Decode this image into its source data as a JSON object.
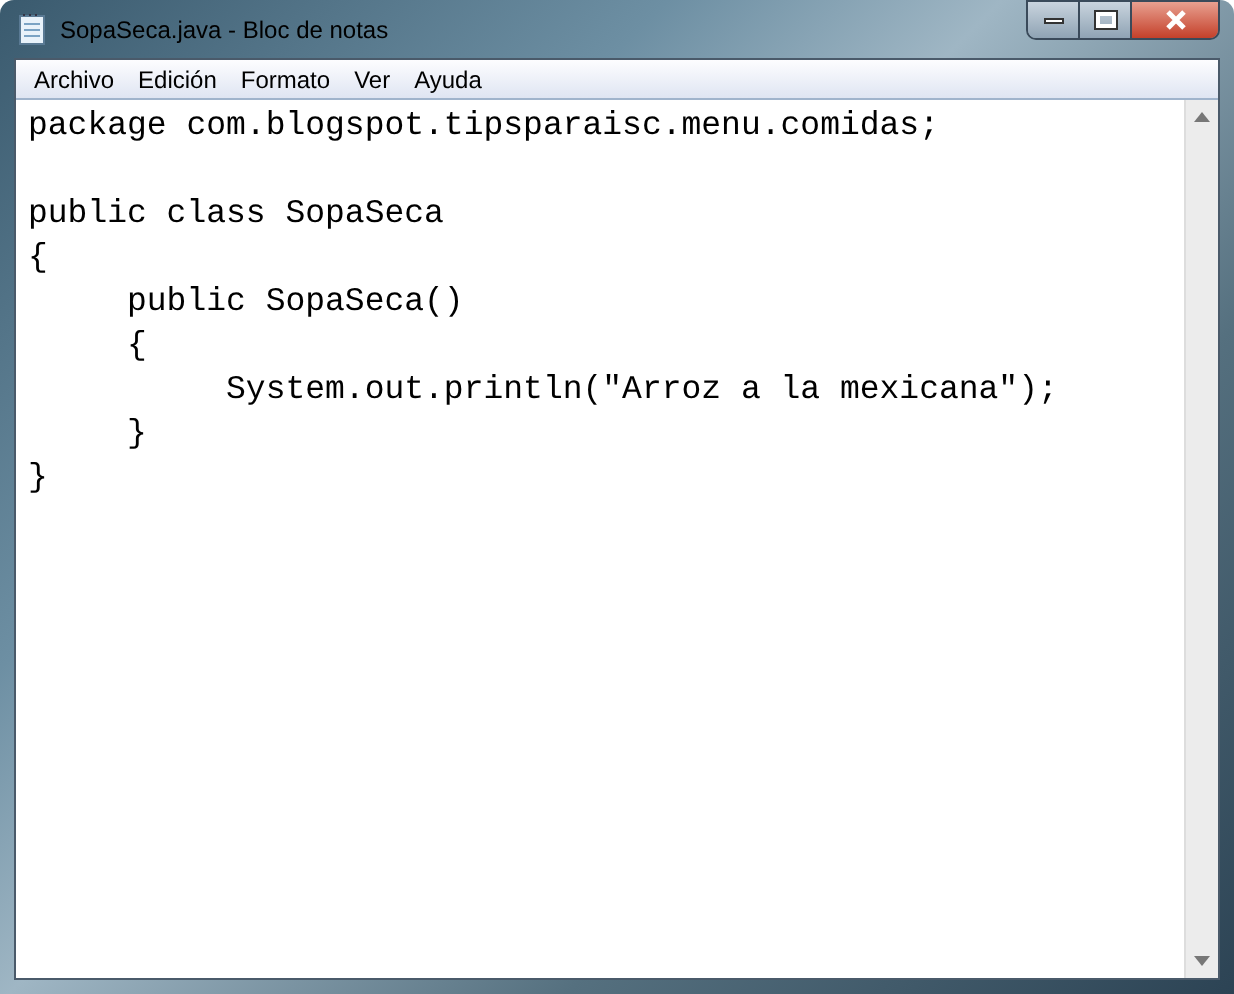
{
  "window": {
    "title": "SopaSeca.java - Bloc de notas"
  },
  "menu": [
    "Archivo",
    "Edición",
    "Formato",
    "Ver",
    "Ayuda"
  ],
  "editor": {
    "content": "package com.blogspot.tipsparaisc.menu.comidas;\n\npublic class SopaSeca\n{\n     public SopaSeca()\n     {\n          System.out.println(\"Arroz a la mexicana\");\n     }\n}"
  }
}
